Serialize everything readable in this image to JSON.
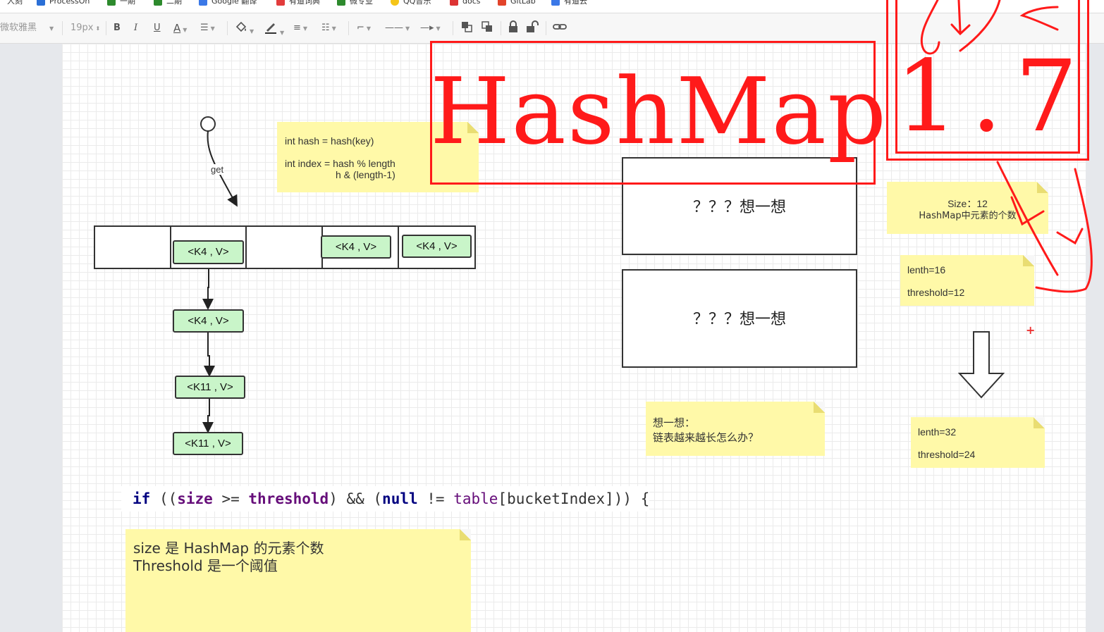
{
  "bookmarks": [
    {
      "label": "人刻",
      "color": "#888"
    },
    {
      "label": "ProcessOn",
      "color": "#2b6fd6"
    },
    {
      "label": "一期",
      "color": "#2d8a2d"
    },
    {
      "label": "二期",
      "color": "#2d8a2d"
    },
    {
      "label": "Google 翻译",
      "color": "#3b78e7"
    },
    {
      "label": "有道词典",
      "color": "#e23c3c"
    },
    {
      "label": "微专业",
      "color": "#2d8a2d"
    },
    {
      "label": "QQ音乐",
      "color": "#f5c518"
    },
    {
      "label": "docs",
      "color": "#d33"
    },
    {
      "label": "GitLab",
      "color": "#e2432a"
    },
    {
      "label": "有道云",
      "color": "#3b78e7"
    }
  ],
  "toolbar": {
    "font_family": "微软雅黑",
    "font_size": "19px",
    "bold": "B",
    "italic": "I",
    "underline": "U",
    "font_color": "A"
  },
  "diagram": {
    "get_label": "get",
    "hash_note": {
      "line1": "int hash = hash(key)",
      "line2": "int index = hash % length",
      "line3": "h & (length-1)"
    },
    "array_nodes": [
      "<K4 , V>",
      "<K4 , V>",
      "<K4 , V>"
    ],
    "chain_nodes": [
      "<K4 , V>",
      "<K11 , V>",
      "<K11 , V>"
    ],
    "think_box_1": "？？？想一想",
    "think_box_2": "？？？想一想",
    "think_note": {
      "line1": "想一想：",
      "line2": "链表越来越长怎么办？"
    },
    "size_note": {
      "line1": "Size：12",
      "line2": "HashMap中元素的个数"
    },
    "before_note": {
      "line1": "lenth=16",
      "line2": "threshold=12"
    },
    "after_note": {
      "line1": "lenth=32",
      "line2": "threshold=24"
    },
    "plus_mark": "+",
    "code": {
      "t1": "if",
      "t2": " ((",
      "t3": "size",
      "t4": " >= ",
      "t5": "threshold",
      "t6": ") && (",
      "t7": "null",
      "t8": " != ",
      "t9": "table",
      "t10": "[bucketIndex])) {"
    },
    "desc_note": {
      "line1": "size 是 HashMap 的元素个数",
      "line2": "Threshold 是一个阈值"
    }
  },
  "annotations": {
    "title": "HashMap",
    "version": "1.7",
    "color": "#ff1a1a"
  }
}
